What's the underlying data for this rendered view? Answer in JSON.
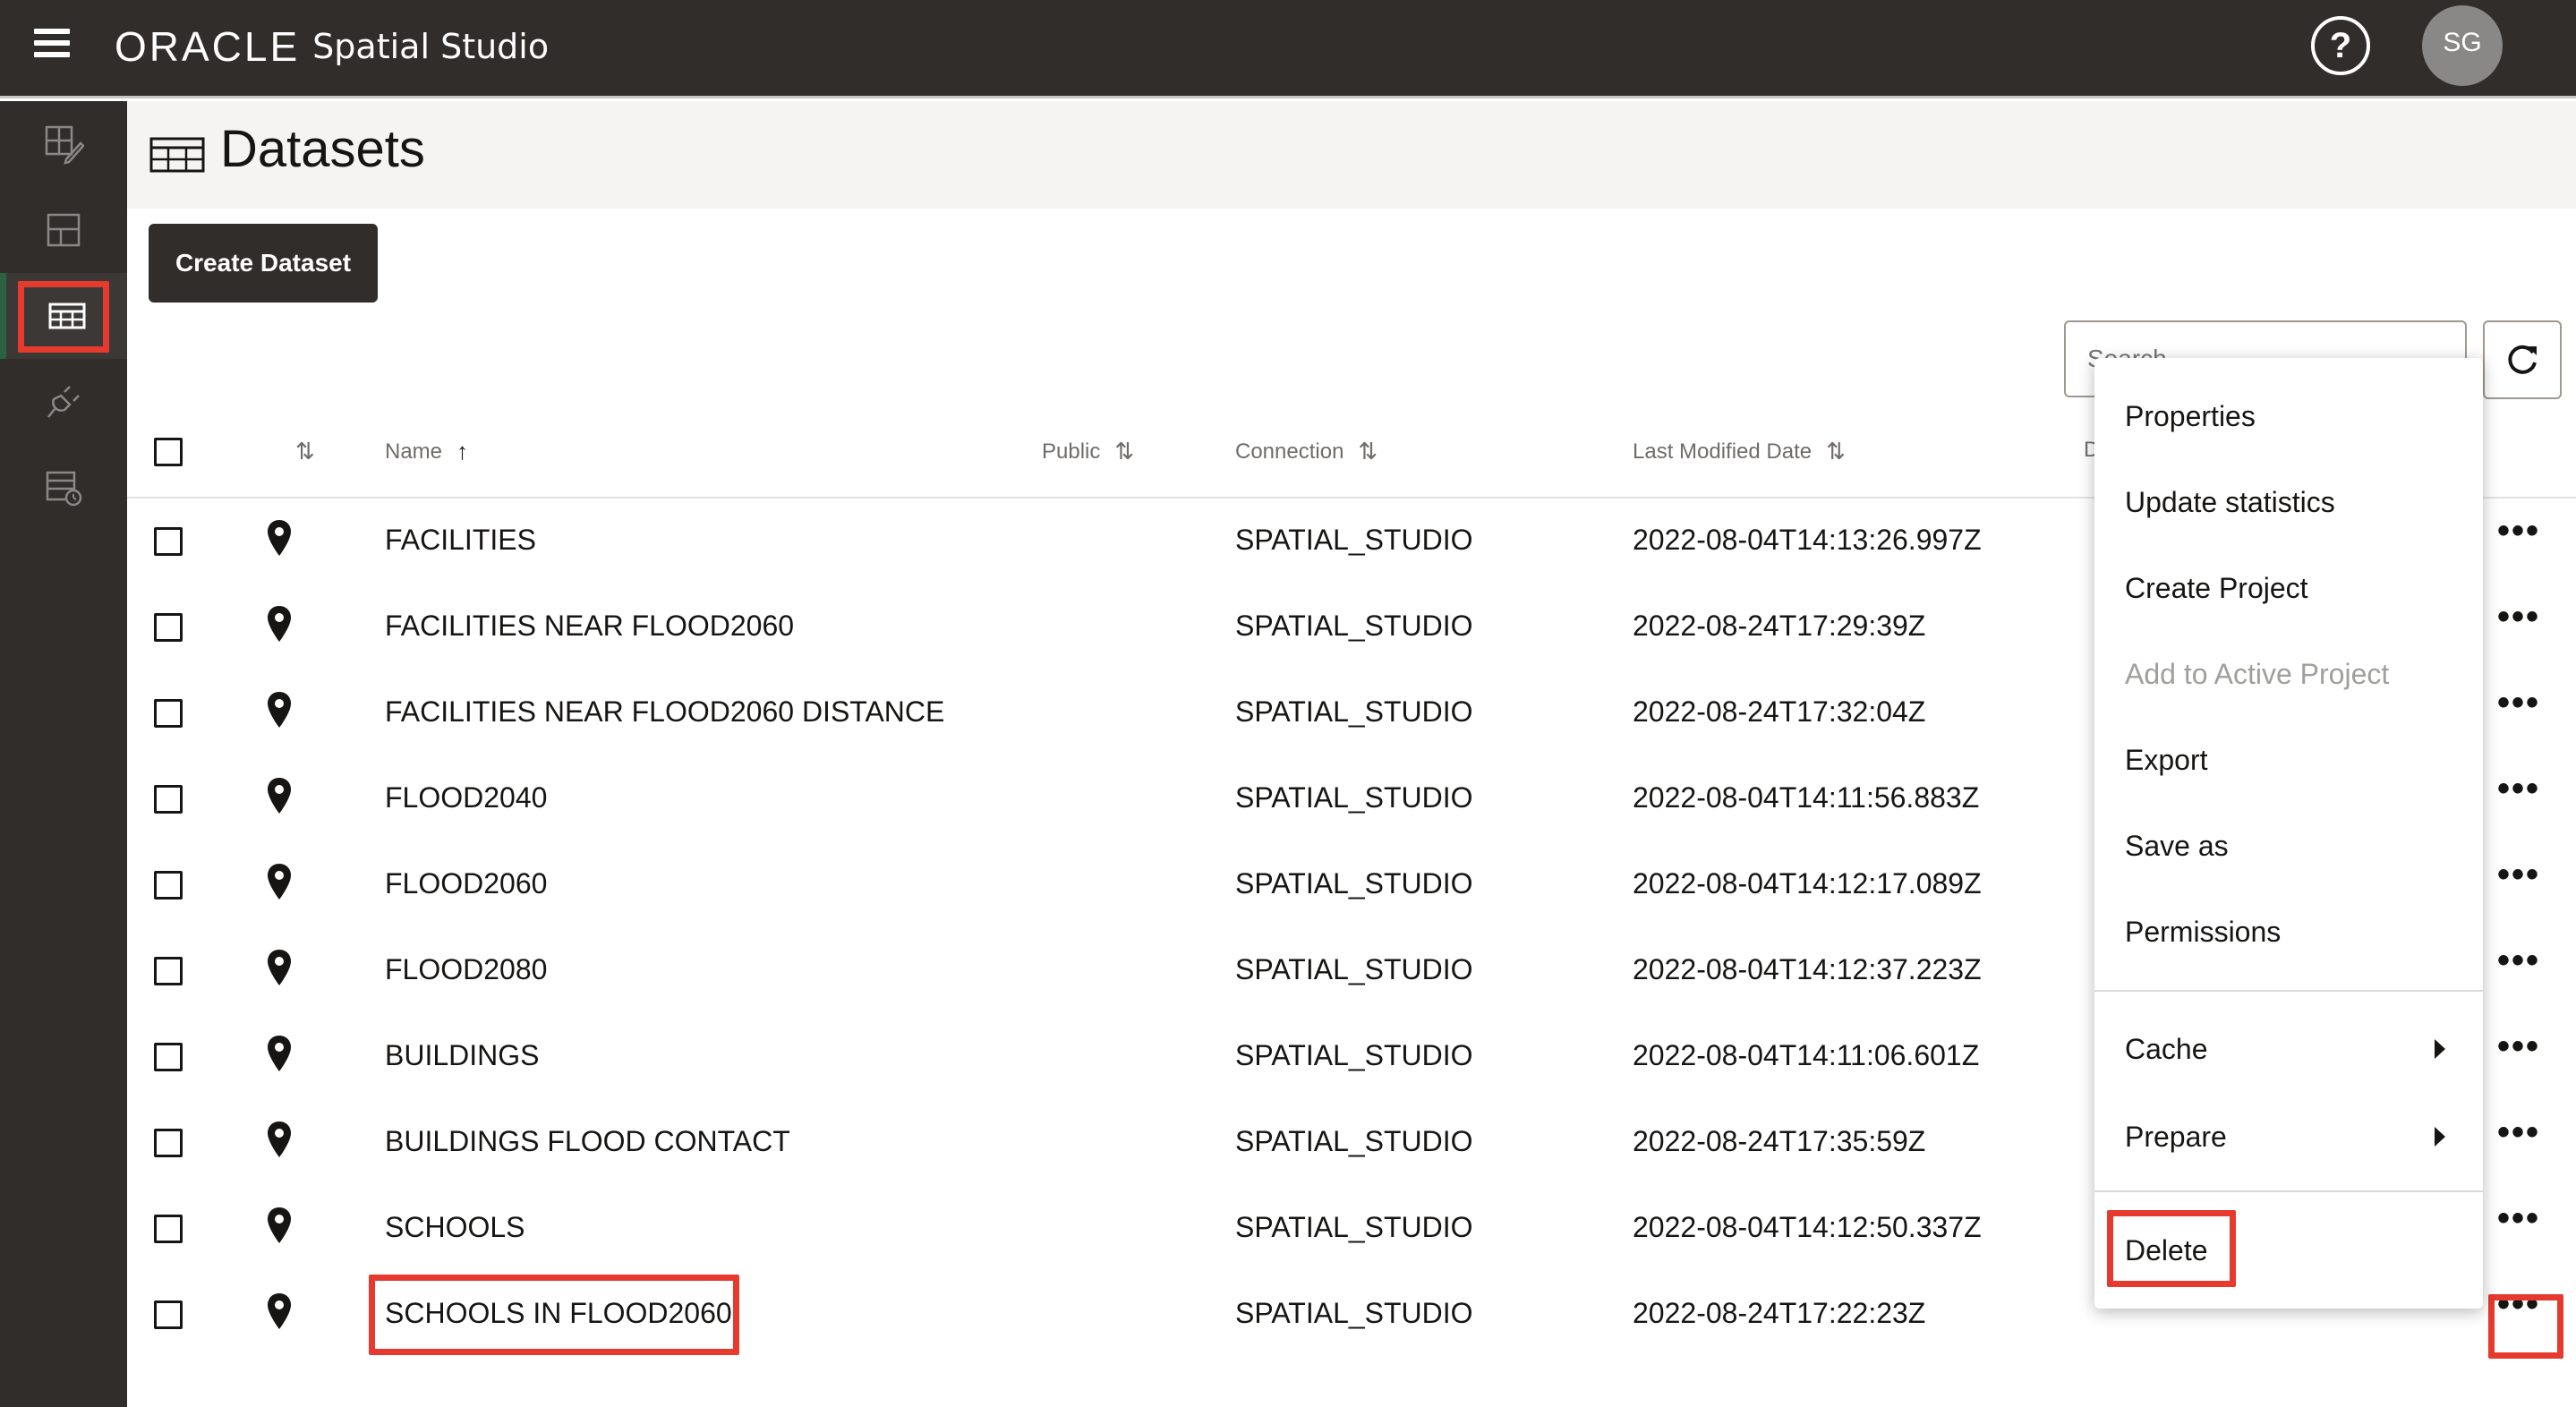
{
  "app": {
    "brand": "ORACLE",
    "product": "Spatial Studio",
    "help_glyph": "?",
    "user_initials": "SG"
  },
  "nav_rail": [
    {
      "name": "projects-nav-icon"
    },
    {
      "name": "dashboards-nav-icon"
    },
    {
      "name": "datasets-nav-icon",
      "active": true
    },
    {
      "name": "connections-nav-icon"
    },
    {
      "name": "jobs-nav-icon"
    }
  ],
  "page": {
    "title": "Datasets",
    "create_button": "Create Dataset",
    "search_placeholder": "Search"
  },
  "table": {
    "headers": {
      "name": "Name",
      "public": "Public",
      "connection": "Connection",
      "last_modified": "Last Modified Date",
      "partial": "D"
    },
    "rows": [
      {
        "name": "FACILITIES",
        "connection": "SPATIAL_STUDIO",
        "modified": "2022-08-04T14:13:26.997Z"
      },
      {
        "name": "FACILITIES NEAR FLOOD2060",
        "connection": "SPATIAL_STUDIO",
        "modified": "2022-08-24T17:29:39Z"
      },
      {
        "name": "FACILITIES NEAR FLOOD2060 DISTANCE",
        "connection": "SPATIAL_STUDIO",
        "modified": "2022-08-24T17:32:04Z"
      },
      {
        "name": "FLOOD2040",
        "connection": "SPATIAL_STUDIO",
        "modified": "2022-08-04T14:11:56.883Z"
      },
      {
        "name": "FLOOD2060",
        "connection": "SPATIAL_STUDIO",
        "modified": "2022-08-04T14:12:17.089Z"
      },
      {
        "name": "FLOOD2080",
        "connection": "SPATIAL_STUDIO",
        "modified": "2022-08-04T14:12:37.223Z"
      },
      {
        "name": "BUILDINGS",
        "connection": "SPATIAL_STUDIO",
        "modified": "2022-08-04T14:11:06.601Z"
      },
      {
        "name": "BUILDINGS FLOOD CONTACT",
        "connection": "SPATIAL_STUDIO",
        "modified": "2022-08-24T17:35:59Z"
      },
      {
        "name": "SCHOOLS",
        "connection": "SPATIAL_STUDIO",
        "modified": "2022-08-04T14:12:50.337Z"
      },
      {
        "name": "SCHOOLS IN FLOOD2060",
        "connection": "SPATIAL_STUDIO",
        "modified": "2022-08-24T17:22:23Z"
      }
    ],
    "more_glyph": "•••"
  },
  "context_menu": {
    "items": [
      {
        "label": "Properties",
        "enabled": true
      },
      {
        "label": "Update statistics",
        "enabled": true
      },
      {
        "label": "Create Project",
        "enabled": true
      },
      {
        "label": "Add to Active Project",
        "enabled": false
      },
      {
        "label": "Export",
        "enabled": true
      },
      {
        "label": "Save as",
        "enabled": true
      },
      {
        "label": "Permissions",
        "enabled": true
      },
      {
        "label": "Cache",
        "enabled": true,
        "submenu": true
      },
      {
        "label": "Prepare",
        "enabled": true,
        "submenu": true
      },
      {
        "label": "Delete",
        "enabled": true
      }
    ]
  },
  "colors": {
    "topbar": "#312d2a",
    "highlight": "#e63a2e",
    "active_accent": "#2b6242"
  }
}
